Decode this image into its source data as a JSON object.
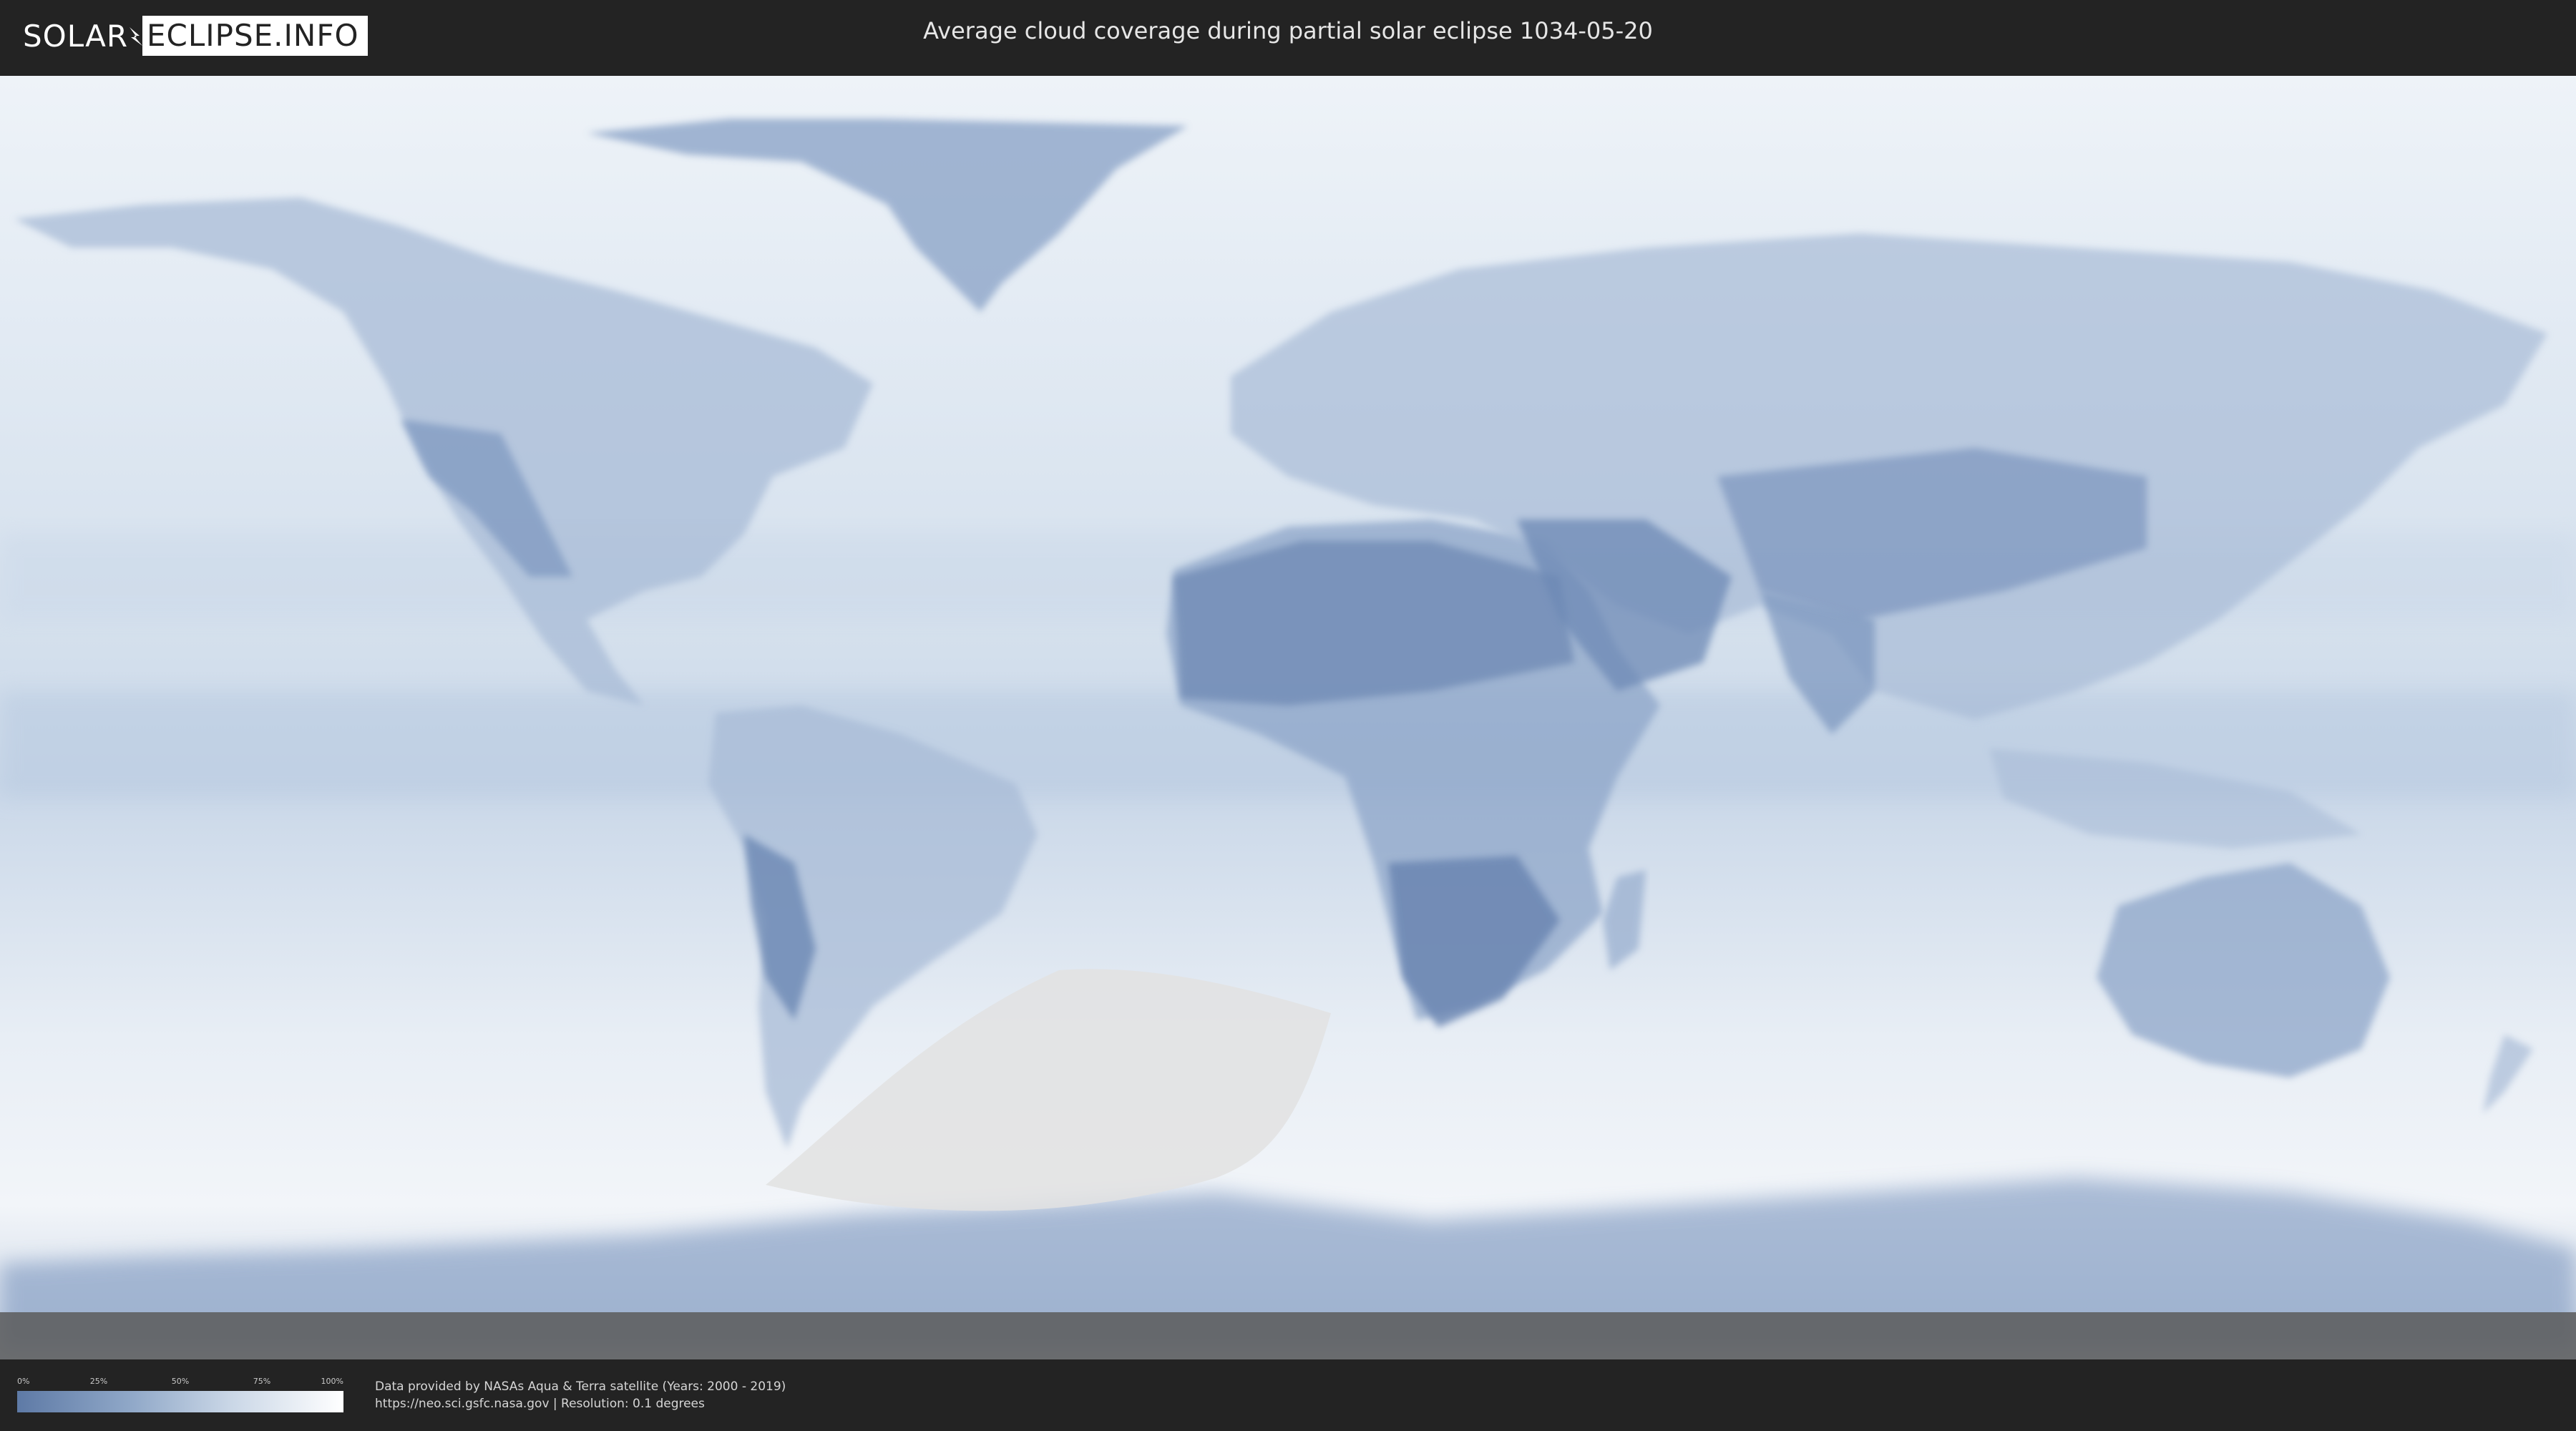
{
  "header": {
    "logo_left": "SOLAR",
    "logo_right": "ECLIPSE.INFO",
    "title": "Average cloud coverage during partial solar eclipse 1034-05-20"
  },
  "legend": {
    "ticks": [
      "0%",
      "25%",
      "50%",
      "75%",
      "100%"
    ],
    "low_color": "#5e7aa6",
    "high_color": "#ffffff"
  },
  "credits": {
    "line1": "Data provided by NASAs Aqua & Terra satellite (Years: 2000 - 2019)",
    "line2": "https://neo.sci.gsfc.nasa.gov | Resolution: 0.1 degrees"
  },
  "map": {
    "projection": "equirectangular",
    "ocean_color": "#dbe5f0",
    "land_clear_color": "#8ea6c9",
    "eclipse_zone_color": "#e2e2e2",
    "eclipse_zone_region": "South Atlantic / Southern Ocean, south of South America and Africa"
  }
}
